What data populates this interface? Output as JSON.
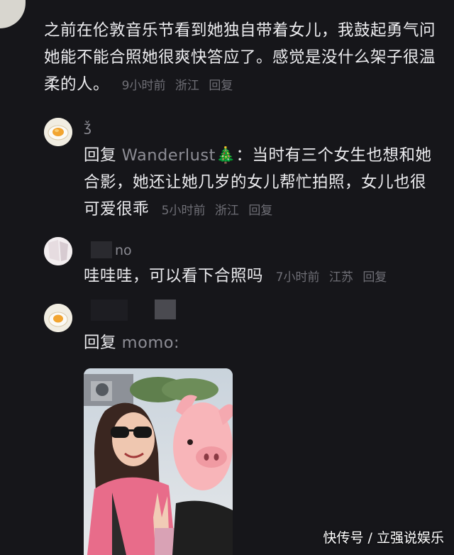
{
  "comment": {
    "text": "之前在伦敦音乐节看到她独自带着女儿，我鼓起勇气问她能不能合照她很爽快答应了。感觉是没什么架子很温柔的人。",
    "time": "9小时前",
    "location": "浙江",
    "reply_label": "回复"
  },
  "replies": [
    {
      "username": "ǯ",
      "prefix": "回复",
      "mention": "Wanderlust🎄",
      "text": "：当时有三个女生也想和她合影，她还让她几岁的女儿帮忙拍照，女儿也很可爱很乖",
      "time": "5小时前",
      "location": "浙江",
      "reply_label": "回复"
    },
    {
      "username": "no",
      "text": "哇哇哇，可以看下合照吗",
      "time": "7小时前",
      "location": "江苏",
      "reply_label": "回复"
    },
    {
      "prefix": "回复",
      "mention": "momo:"
    }
  ],
  "watermark": "快传号 / 立强说娱乐"
}
